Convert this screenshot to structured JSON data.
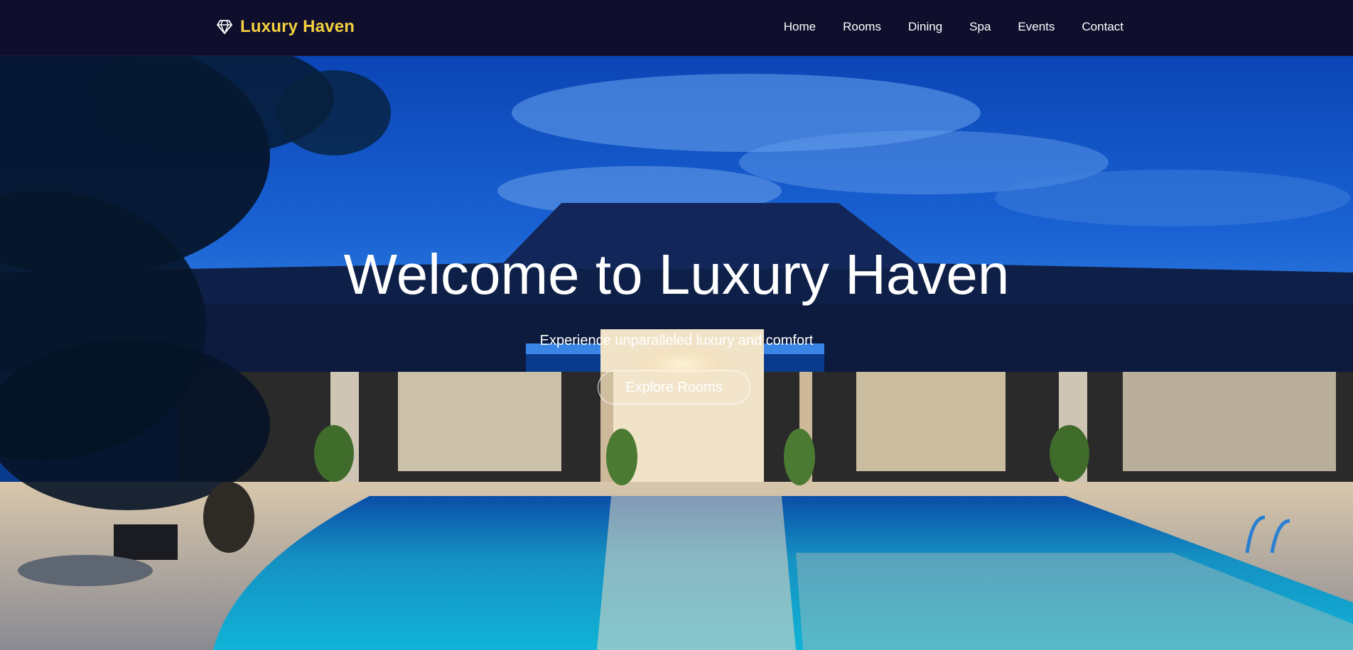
{
  "brand": {
    "name": "Luxury Haven",
    "icon": "diamond-icon",
    "color": "#f4d03f"
  },
  "nav": {
    "items": [
      {
        "label": "Home"
      },
      {
        "label": "Rooms"
      },
      {
        "label": "Dining"
      },
      {
        "label": "Spa"
      },
      {
        "label": "Events"
      },
      {
        "label": "Contact"
      }
    ]
  },
  "hero": {
    "title": "Welcome to Luxury Haven",
    "subtitle": "Experience unparalleled luxury and comfort",
    "cta_label": "Explore Rooms",
    "background": "hotel-pool-night-photo"
  },
  "colors": {
    "navbar": "#0f0f2d",
    "sky": "#1757c7",
    "pool": "#14a3c8",
    "text": "#ffffff"
  }
}
